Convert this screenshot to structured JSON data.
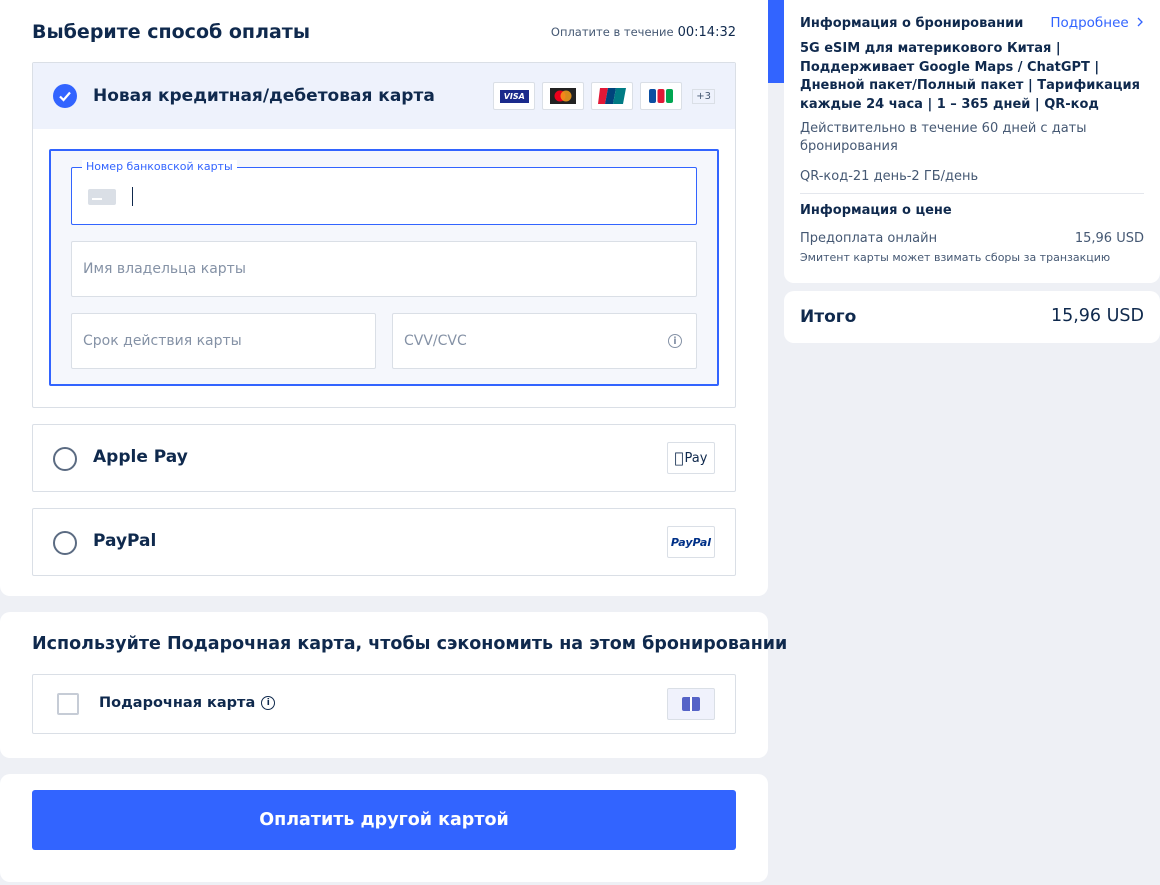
{
  "payment": {
    "title": "Выберите способ оплаты",
    "timer_label": "Оплатите в течение",
    "timer_value": "00:14:32",
    "card": {
      "label": "Новая кредитная/дебетовая карта",
      "brands": [
        "VISA",
        "Mastercard",
        "UnionPay",
        "JCB"
      ],
      "more_brands": "+3",
      "number_label": "Номер банковской карты",
      "holder_placeholder": "Имя владельца карты",
      "expiry_placeholder": "Срок действия карты",
      "cvv_placeholder": "CVV/CVC"
    },
    "apple_pay": {
      "label": "Apple Pay",
      "logo": "Pay"
    },
    "paypal": {
      "label": "PayPal",
      "logo": "PayPal"
    }
  },
  "gift": {
    "title": "Используйте Подарочная карта, чтобы сэкономить на этом бронировании",
    "label": "Подарочная карта"
  },
  "pay_button": "Оплатить другой картой",
  "summary": {
    "title": "Информация о бронировании",
    "more_link": "Подробнее",
    "product": "5G eSIM для материкового Китая | Поддерживает Google Maps / ChatGPT | Дневной пакет/Полный пакет | Тарификация каждые 24 часа | 1 – 365 дней | QR-код",
    "validity": "Действительно в течение 60 дней с даты бронирования",
    "variant": "QR-код-21 день-2 ГБ/день",
    "price_title": "Информация о цене",
    "prepay_label": "Предоплата онлайн",
    "prepay_value": "15,96 USD",
    "fee_note": "Эмитент карты может взимать сборы за транзакцию",
    "total_label": "Итого",
    "total_value": "15,96 USD"
  },
  "colors": {
    "accent": "#3264ff",
    "text": "#0f294d",
    "muted": "#455873"
  }
}
